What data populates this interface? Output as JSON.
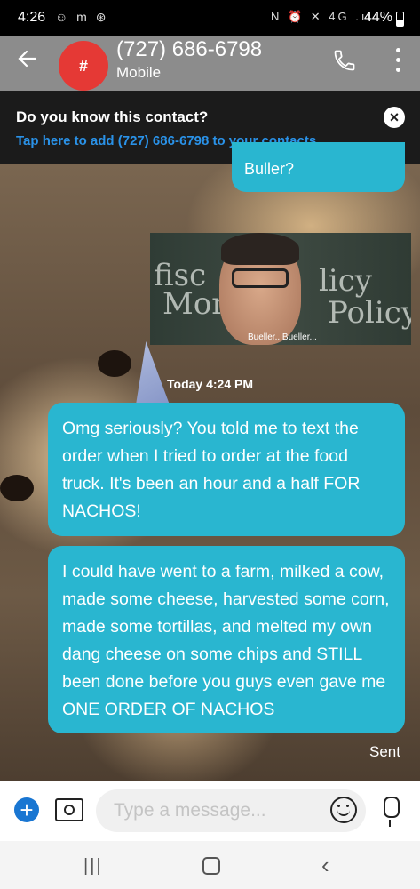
{
  "status_bar": {
    "time": "4:26",
    "left_icons": "☺ m ⊛",
    "right_icons": "N ⏰ ✕ 4G .ıl",
    "battery": "44%"
  },
  "header": {
    "avatar_text": "#",
    "contact_number": "(727) 686-6798",
    "contact_type": "Mobile"
  },
  "banner": {
    "title": "Do you know this contact?",
    "link": "Tap here to add (727) 686-6798 to your contacts"
  },
  "messages": {
    "partial_top": "Buller?",
    "gif_caption": "Bueller...Bueller...",
    "gif_chalk_1": "fisc",
    "gif_chalk_2": "licy",
    "gif_chalk_3": "Mon",
    "gif_chalk_4": "Policy",
    "timestamp": "Today 4:24 PM",
    "msg1": "Omg seriously? You told me to text the order when I tried to order at the food truck. It's been an hour and a half FOR NACHOS!",
    "msg2": "I could have went to a farm, milked a cow, made some cheese, harvested some corn, made some tortillas, and melted my own dang cheese on some chips and STILL been done before you guys even gave me ONE ORDER OF NACHOS",
    "status": "Sent"
  },
  "composer": {
    "placeholder": "Type a message..."
  },
  "icons": {
    "back": "arrow-left",
    "call": "phone",
    "menu": "more-vertical",
    "close": "close",
    "add": "plus",
    "camera": "camera",
    "emoji": "smiley",
    "mic": "microphone"
  },
  "colors": {
    "bubble": "#29b6d0",
    "avatar": "#e53935",
    "link": "#2a92e8",
    "header": "#8c8c8c",
    "banner": "#1b1b1b"
  }
}
